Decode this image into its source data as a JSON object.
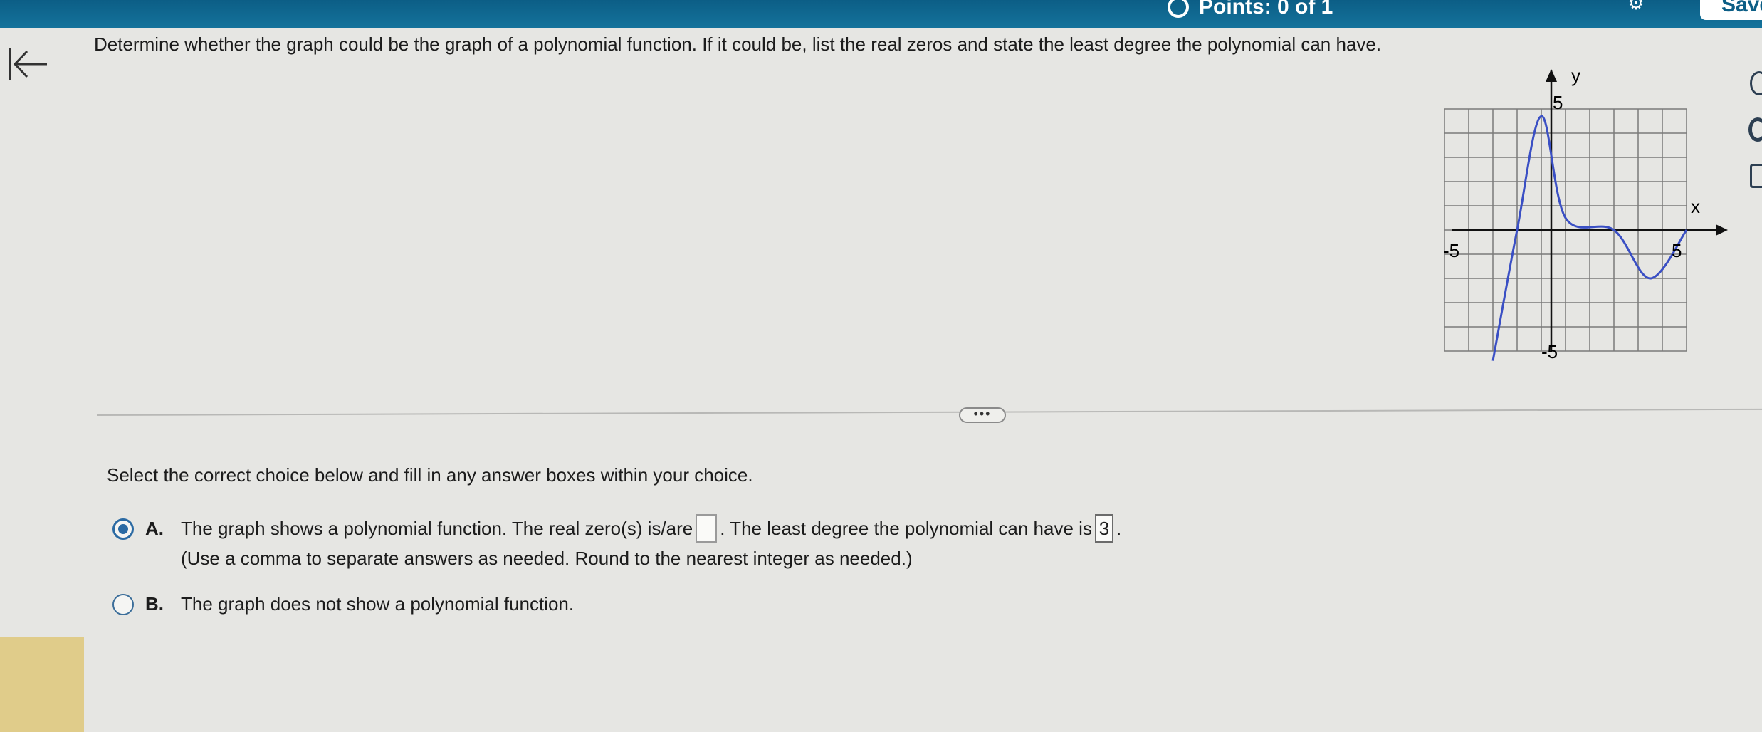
{
  "header": {
    "points_label": "Points: 0 of 1",
    "save_label": "Save",
    "accent_color": "#0c5e86"
  },
  "question": {
    "text": "Determine whether the graph could be the graph of a polynomial function. If it could be, list the real zeros and state the least degree the polynomial can have."
  },
  "graph": {
    "x_axis_label": "x",
    "y_axis_label": "y",
    "x_min_label": "-5",
    "x_max_label": "5",
    "y_max_label": "5",
    "y_min_label": "-5",
    "curve_color": "#3a4fc4",
    "chart_data": {
      "type": "line",
      "xlim": [
        -5,
        5
      ],
      "ylim": [
        -5,
        5
      ],
      "grid": true,
      "points": [
        {
          "x": -3,
          "y": -5.4
        },
        {
          "x": -2,
          "y": 0
        },
        {
          "x": -1,
          "y": 4.7
        },
        {
          "x": 0,
          "y": 0.5
        },
        {
          "x": 2,
          "y": 0
        },
        {
          "x": 3.5,
          "y": -2
        },
        {
          "x": 5,
          "y": 0
        }
      ]
    }
  },
  "more_label": "•••",
  "instruction": "Select the correct choice below and fill in any answer boxes within your choice.",
  "choices": {
    "a": {
      "letter": "A.",
      "text_before": "The graph shows a polynomial function. The real zero(s) is/are",
      "text_middle": ". The least degree the polynomial can have is",
      "degree_value": "3",
      "text_after": ".",
      "note": "(Use a comma to separate answers as needed.  Round to the nearest integer as needed.)",
      "selected": true
    },
    "b": {
      "letter": "B.",
      "text": "The graph does not show a polynomial function.",
      "selected": false
    }
  }
}
